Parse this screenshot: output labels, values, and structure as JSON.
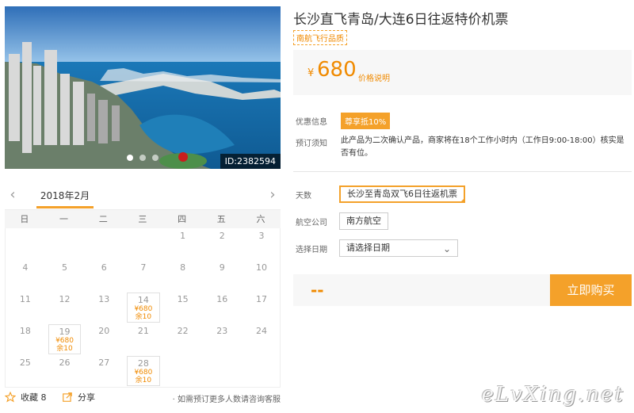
{
  "hero": {
    "id_label": "ID:2382594"
  },
  "calendar": {
    "month": "2018年2月",
    "prev": "‹",
    "next": "›",
    "weekdays": [
      "日",
      "一",
      "二",
      "三",
      "四",
      "五",
      "六"
    ],
    "cells": [
      {
        "d": ""
      },
      {
        "d": ""
      },
      {
        "d": ""
      },
      {
        "d": ""
      },
      {
        "d": "1"
      },
      {
        "d": "2"
      },
      {
        "d": "3"
      },
      {
        "d": "4"
      },
      {
        "d": "5"
      },
      {
        "d": "6"
      },
      {
        "d": "7"
      },
      {
        "d": "8"
      },
      {
        "d": "9"
      },
      {
        "d": "10"
      },
      {
        "d": "11"
      },
      {
        "d": "12"
      },
      {
        "d": "13"
      },
      {
        "d": "14",
        "p": "¥680",
        "r": "余10"
      },
      {
        "d": "15"
      },
      {
        "d": "16"
      },
      {
        "d": "17"
      },
      {
        "d": "18"
      },
      {
        "d": "19",
        "p": "¥680",
        "r": "余10"
      },
      {
        "d": "20"
      },
      {
        "d": "21"
      },
      {
        "d": "22"
      },
      {
        "d": "23"
      },
      {
        "d": "24"
      },
      {
        "d": "25"
      },
      {
        "d": "26"
      },
      {
        "d": "27"
      },
      {
        "d": "28",
        "p": "¥680",
        "r": "余10"
      },
      {
        "d": ""
      },
      {
        "d": ""
      },
      {
        "d": ""
      }
    ]
  },
  "footer": {
    "fav_label": "收藏 8",
    "share_label": "分享",
    "note": "· 如需预订更多人数请咨询客服"
  },
  "product": {
    "title": "长沙直飞青岛/大连6日往返特价机票",
    "tag": "南航飞行品质",
    "currency": "¥",
    "price": "680",
    "price_explain": "价格说明",
    "promo_label": "优惠信息",
    "promo_badge": "尊享抵10%",
    "notice_label": "预订须知",
    "notice_text": "此产品为二次确认产品，商家将在18个工作小时内（工作日9:00-18:00）核实是否有位。",
    "days_label": "天数",
    "days_option": "长沙至青岛双飞6日往返机票",
    "airline_label": "航空公司",
    "airline_option": "南方航空",
    "date_label": "选择日期",
    "date_placeholder": "请选择日期",
    "total": "--",
    "buy_label": "立即购买"
  },
  "watermark": "eLvXing.net",
  "colors": {
    "accent": "#f4a12a",
    "price": "#f08a00"
  }
}
